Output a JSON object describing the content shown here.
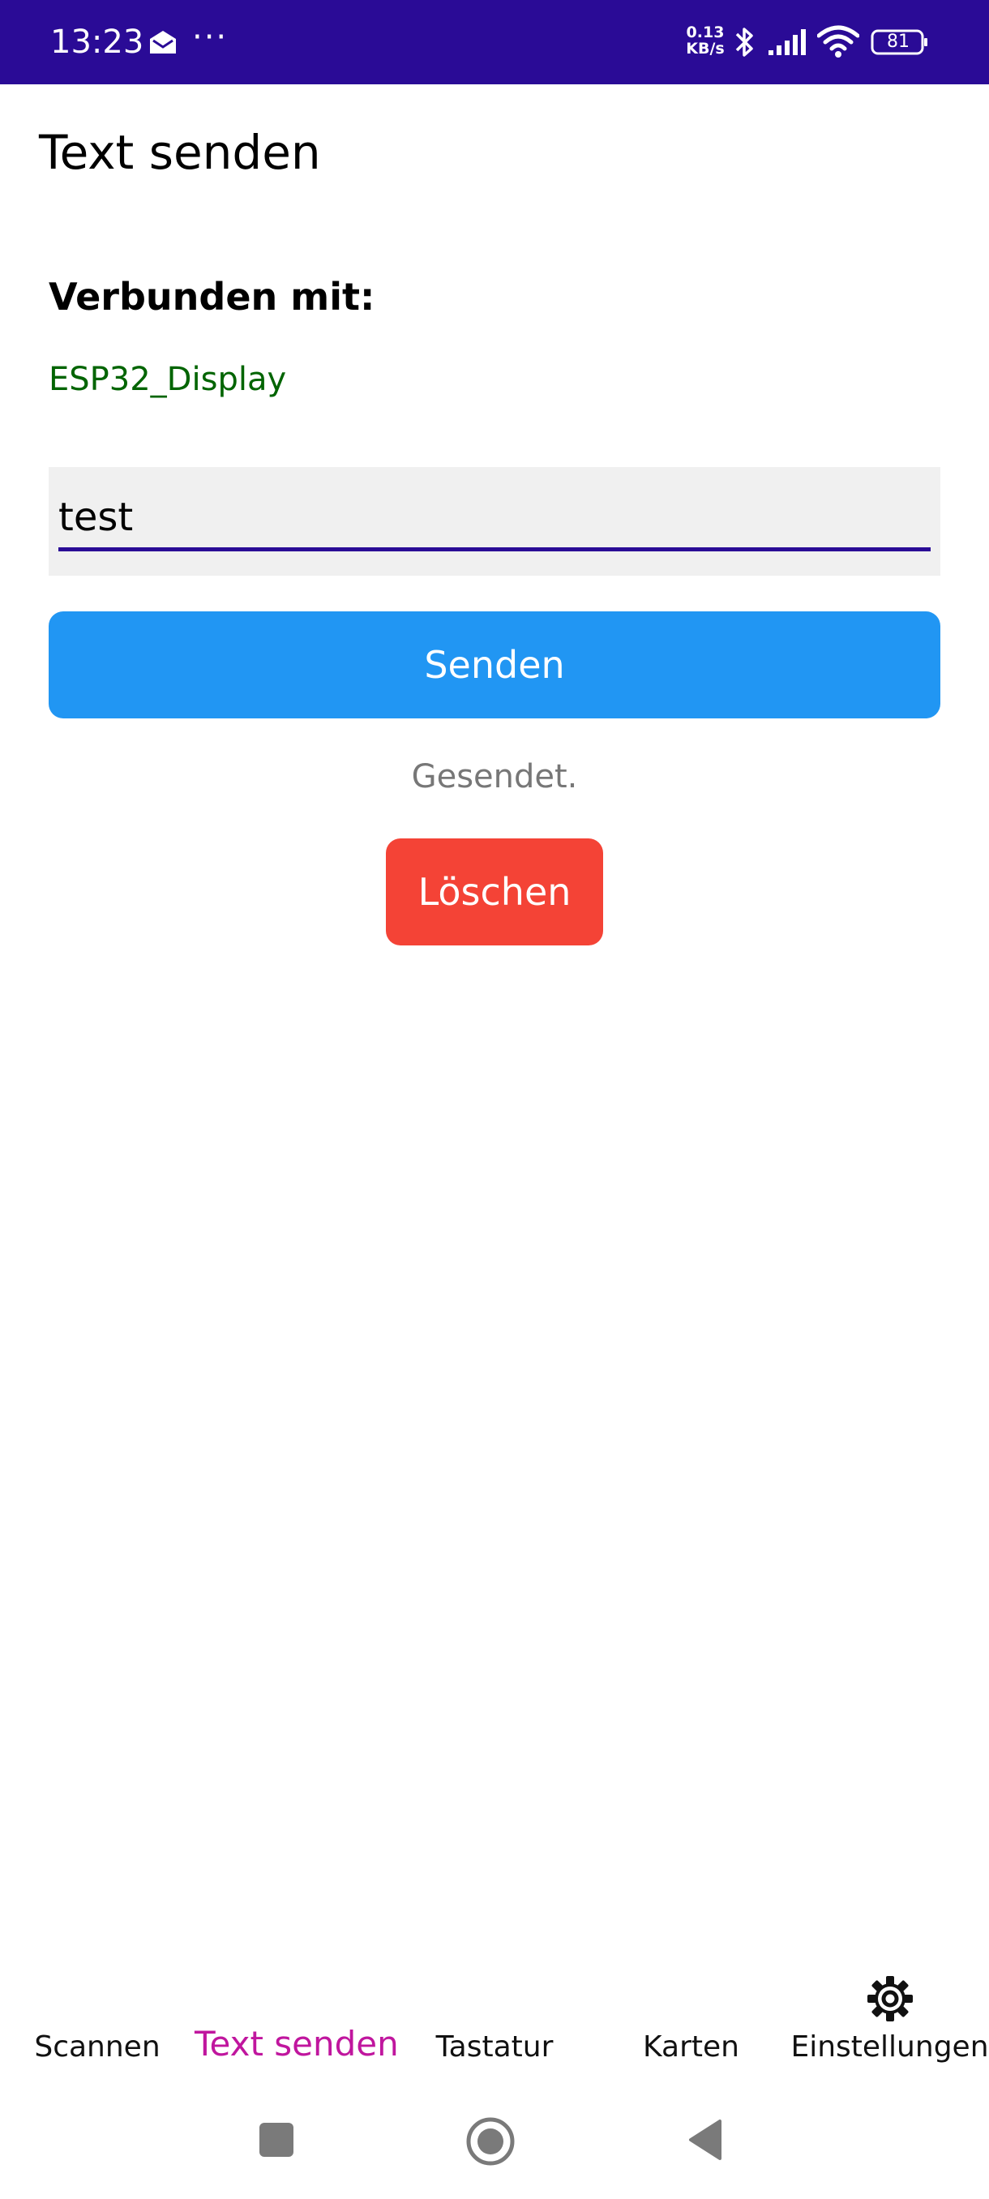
{
  "status_bar": {
    "time": "13:23",
    "dots": "···",
    "speed_value": "0.13",
    "speed_unit": "KB/s",
    "battery_level": "81",
    "background_color": "#2a0b96",
    "icons": [
      "mail-icon",
      "bluetooth-icon",
      "signal-icon",
      "wifi-icon",
      "battery-icon"
    ]
  },
  "header": {
    "title": "Text senden"
  },
  "main": {
    "connected_label": "Verbunden mit:",
    "device_name": "ESP32_Display",
    "device_name_color": "#006400",
    "text_input_value": "test",
    "send_label": "Senden",
    "send_color": "#2196f3",
    "status_message": "Gesendet.",
    "delete_label": "Löschen",
    "delete_color": "#f44336"
  },
  "bottom_nav": {
    "items": [
      {
        "label": "Scannen",
        "active": false
      },
      {
        "label": "Text senden",
        "active": true
      },
      {
        "label": "Tastatur",
        "active": false
      },
      {
        "label": "Karten",
        "active": false
      },
      {
        "label": "Einstellungen",
        "active": false,
        "icon": "gear-icon"
      }
    ],
    "active_color": "#c0169e"
  },
  "system_nav": {
    "buttons": [
      "recents-button",
      "home-button",
      "back-button"
    ]
  }
}
